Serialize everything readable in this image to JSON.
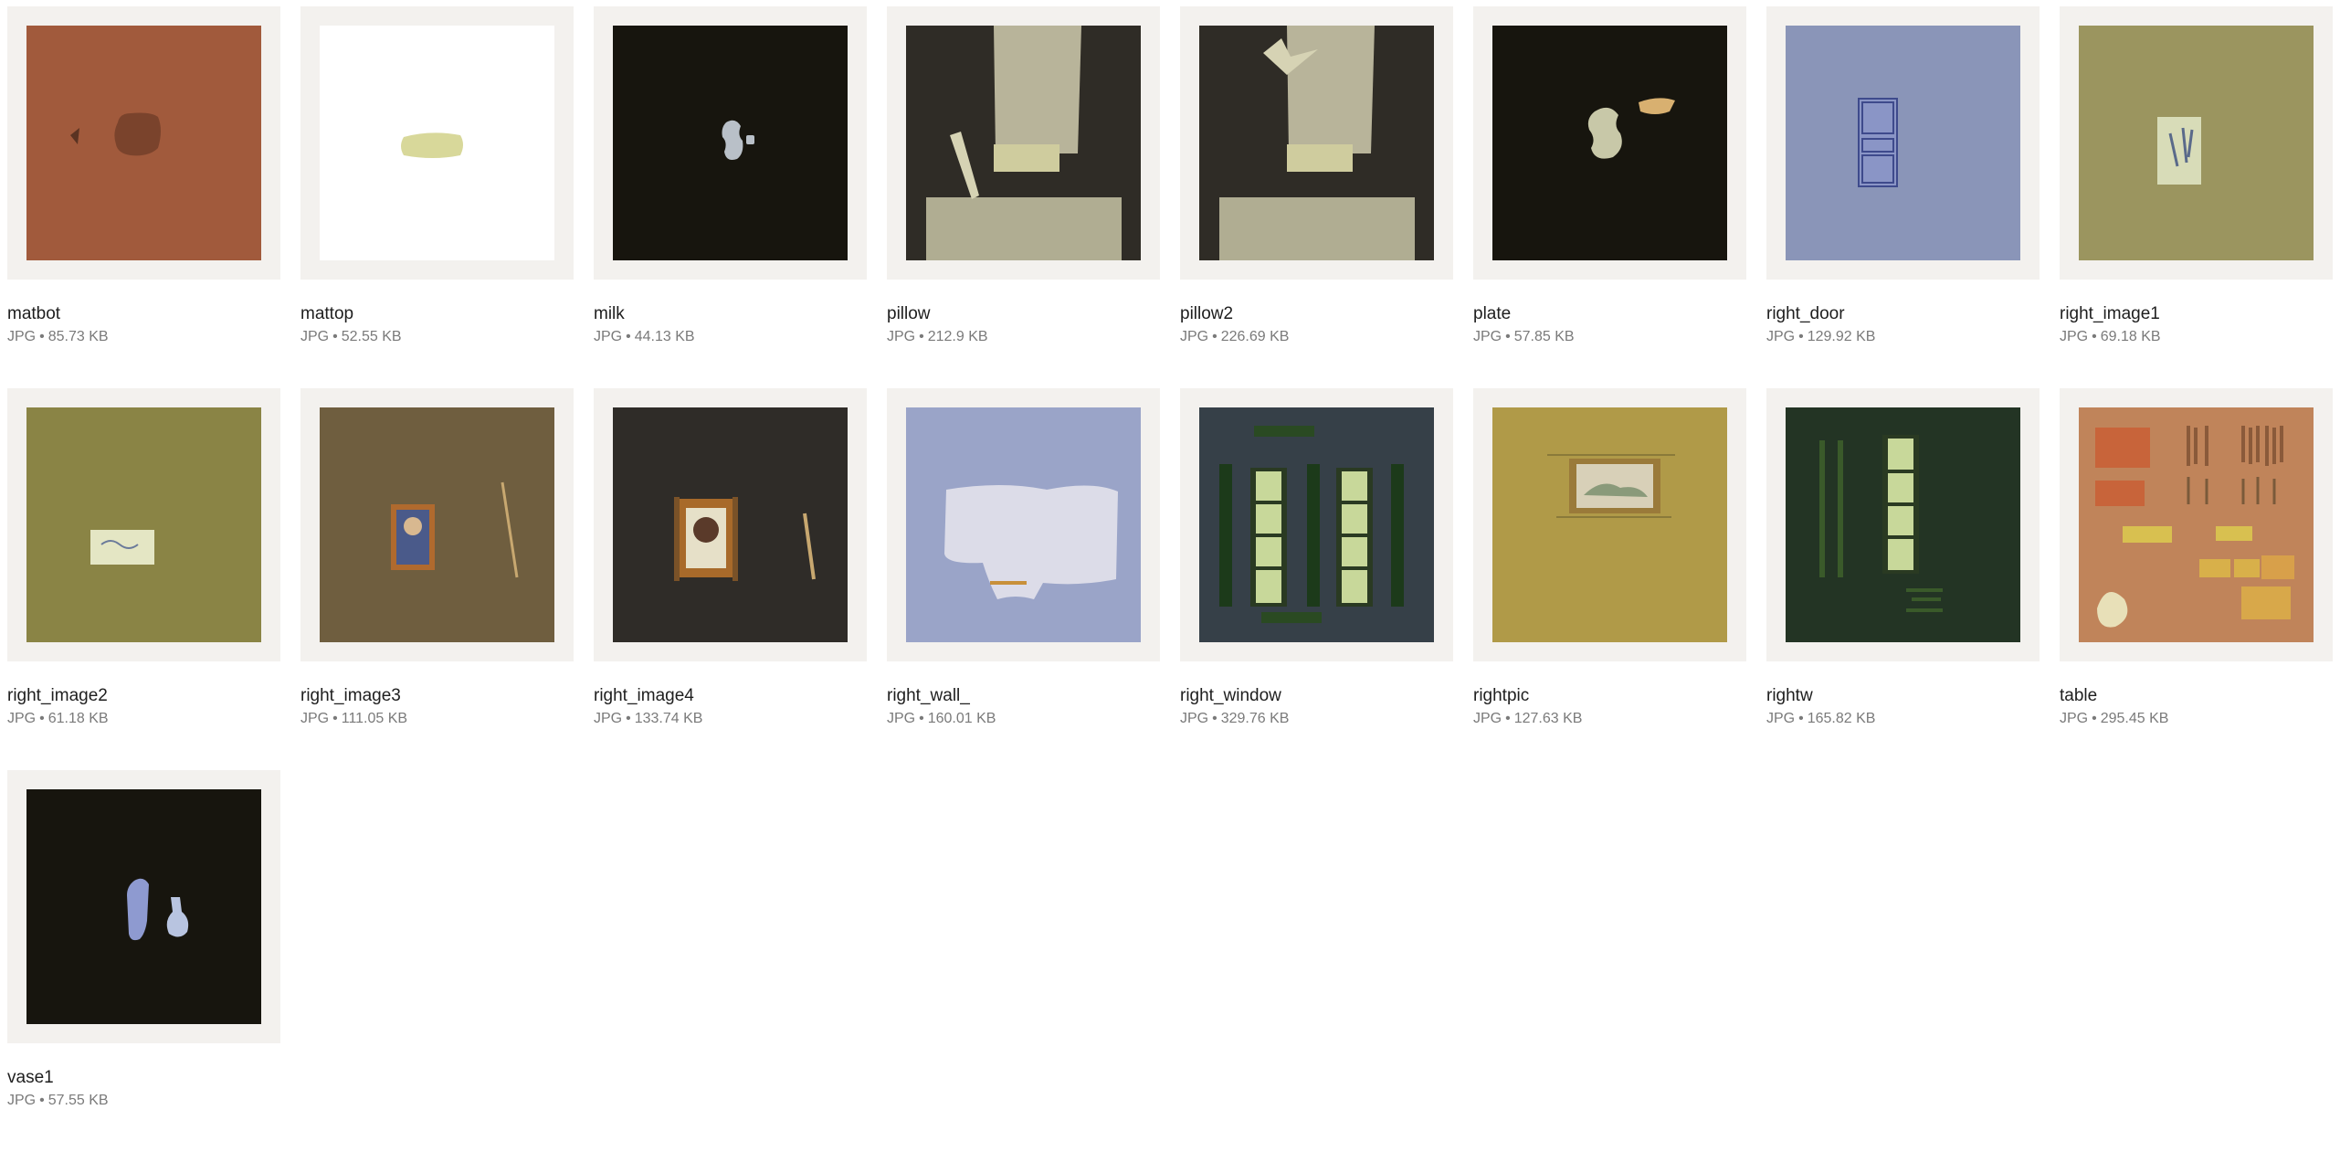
{
  "files": [
    {
      "name": "matbot",
      "type": "JPG",
      "size": "85.73 KB",
      "bg": "#a15a3c",
      "icon": "texture-thumbnail"
    },
    {
      "name": "mattop",
      "type": "JPG",
      "size": "52.55 KB",
      "bg": "#ffffff",
      "icon": "texture-thumbnail"
    },
    {
      "name": "milk",
      "type": "JPG",
      "size": "44.13 KB",
      "bg": "#17150e",
      "icon": "texture-thumbnail"
    },
    {
      "name": "pillow",
      "type": "JPG",
      "size": "212.9 KB",
      "bg": "#2f2c26",
      "icon": "texture-thumbnail"
    },
    {
      "name": "pillow2",
      "type": "JPG",
      "size": "226.69 KB",
      "bg": "#2f2c26",
      "icon": "texture-thumbnail"
    },
    {
      "name": "plate",
      "type": "JPG",
      "size": "57.85 KB",
      "bg": "#17150e",
      "icon": "texture-thumbnail"
    },
    {
      "name": "right_door",
      "type": "JPG",
      "size": "129.92 KB",
      "bg": "#8a95b8",
      "icon": "texture-thumbnail"
    },
    {
      "name": "right_image1",
      "type": "JPG",
      "size": "69.18 KB",
      "bg": "#9b955f",
      "icon": "texture-thumbnail"
    },
    {
      "name": "right_image2",
      "type": "JPG",
      "size": "61.18 KB",
      "bg": "#8a8445",
      "icon": "texture-thumbnail"
    },
    {
      "name": "right_image3",
      "type": "JPG",
      "size": "111.05 KB",
      "bg": "#6f5e3f",
      "icon": "texture-thumbnail"
    },
    {
      "name": "right_image4",
      "type": "JPG",
      "size": "133.74 KB",
      "bg": "#2f2c28",
      "icon": "texture-thumbnail"
    },
    {
      "name": "right_wall_",
      "type": "JPG",
      "size": "160.01 KB",
      "bg": "#9aa4c8",
      "icon": "texture-thumbnail"
    },
    {
      "name": "right_window",
      "type": "JPG",
      "size": "329.76 KB",
      "bg": "#364048",
      "icon": "texture-thumbnail"
    },
    {
      "name": "rightpic",
      "type": "JPG",
      "size": "127.63 KB",
      "bg": "#b09a48",
      "icon": "texture-thumbnail"
    },
    {
      "name": "rightw",
      "type": "JPG",
      "size": "165.82 KB",
      "bg": "#233424",
      "icon": "texture-thumbnail"
    },
    {
      "name": "table",
      "type": "JPG",
      "size": "295.45 KB",
      "bg": "#c0845a",
      "icon": "texture-thumbnail"
    },
    {
      "name": "vase1",
      "type": "JPG",
      "size": "57.55 KB",
      "bg": "#17150e",
      "icon": "texture-thumbnail"
    }
  ],
  "separator": "•"
}
